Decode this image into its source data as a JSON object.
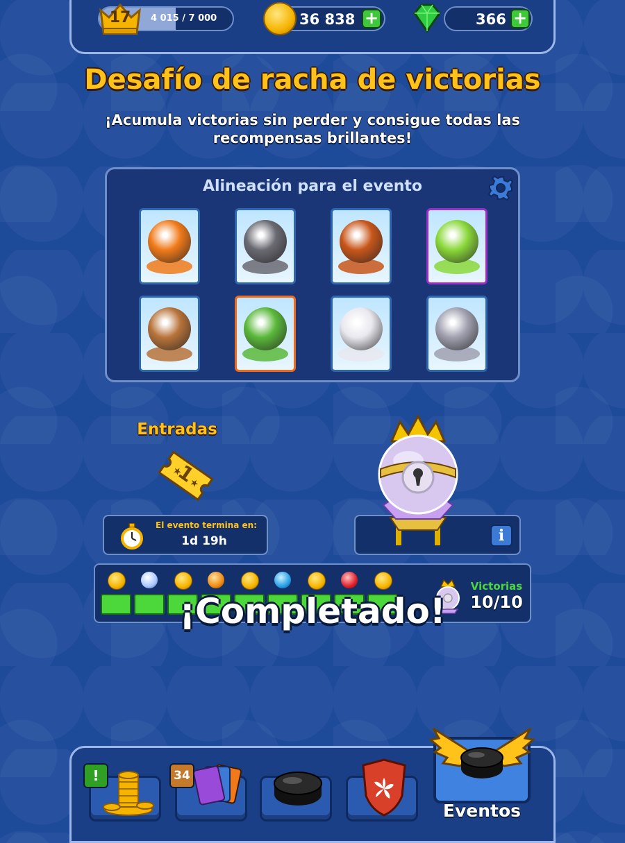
{
  "top_bar": {
    "level": "17",
    "xp_text": "4 015 / 7 000",
    "xp_progress": 0.5736,
    "coins": "36 838",
    "gems": "366",
    "add_symbol": "+"
  },
  "header": {
    "title": "Desafío de racha de victorias",
    "subtitle": "¡Acumula victorias sin perder y consigue todas las recompensas brillantes!"
  },
  "lineup": {
    "title": "Alineación para el evento",
    "cards": [
      {
        "icon": "fire-rock-character-icon",
        "frame": "blue",
        "color": "#f07a1a"
      },
      {
        "icon": "bear-boxer-character-icon",
        "frame": "blue",
        "color": "#6a6a72"
      },
      {
        "icon": "bull-boxer-character-icon",
        "frame": "blue",
        "color": "#c8561a"
      },
      {
        "icon": "frog-character-icon",
        "frame": "purple",
        "color": "#8ad83a"
      },
      {
        "icon": "dog-hockey-player-icon",
        "frame": "blue",
        "color": "#b8733a"
      },
      {
        "icon": "green-blob-character-icon",
        "frame": "orange",
        "color": "#5ab83a"
      },
      {
        "icon": "panda-hockey-player-icon",
        "frame": "blue",
        "color": "#e8e8ee"
      },
      {
        "icon": "koala-hockey-player-icon",
        "frame": "blue",
        "color": "#a0a0b0"
      }
    ]
  },
  "entries": {
    "label": "Entradas",
    "count": "1"
  },
  "timer": {
    "label": "El evento termina en:",
    "value": "1d 19h"
  },
  "info_symbol": "i",
  "progress": {
    "rewards": [
      "coin",
      "orb-w",
      "coin",
      "orb-o",
      "coin",
      "orb-b",
      "coin",
      "orb-r",
      "coin"
    ],
    "segments_filled": 10,
    "segments_total": 10,
    "victories_label": "Victorias",
    "victories_value": "10/10",
    "completed_text": "¡Completado!"
  },
  "nav": {
    "shop_badge": "!",
    "cards_badge": "34",
    "events_label": "Eventos"
  },
  "colors": {
    "background": "#1e4a9a",
    "accent_gold": "#ffc21a",
    "progress_green": "#4cd83a"
  }
}
